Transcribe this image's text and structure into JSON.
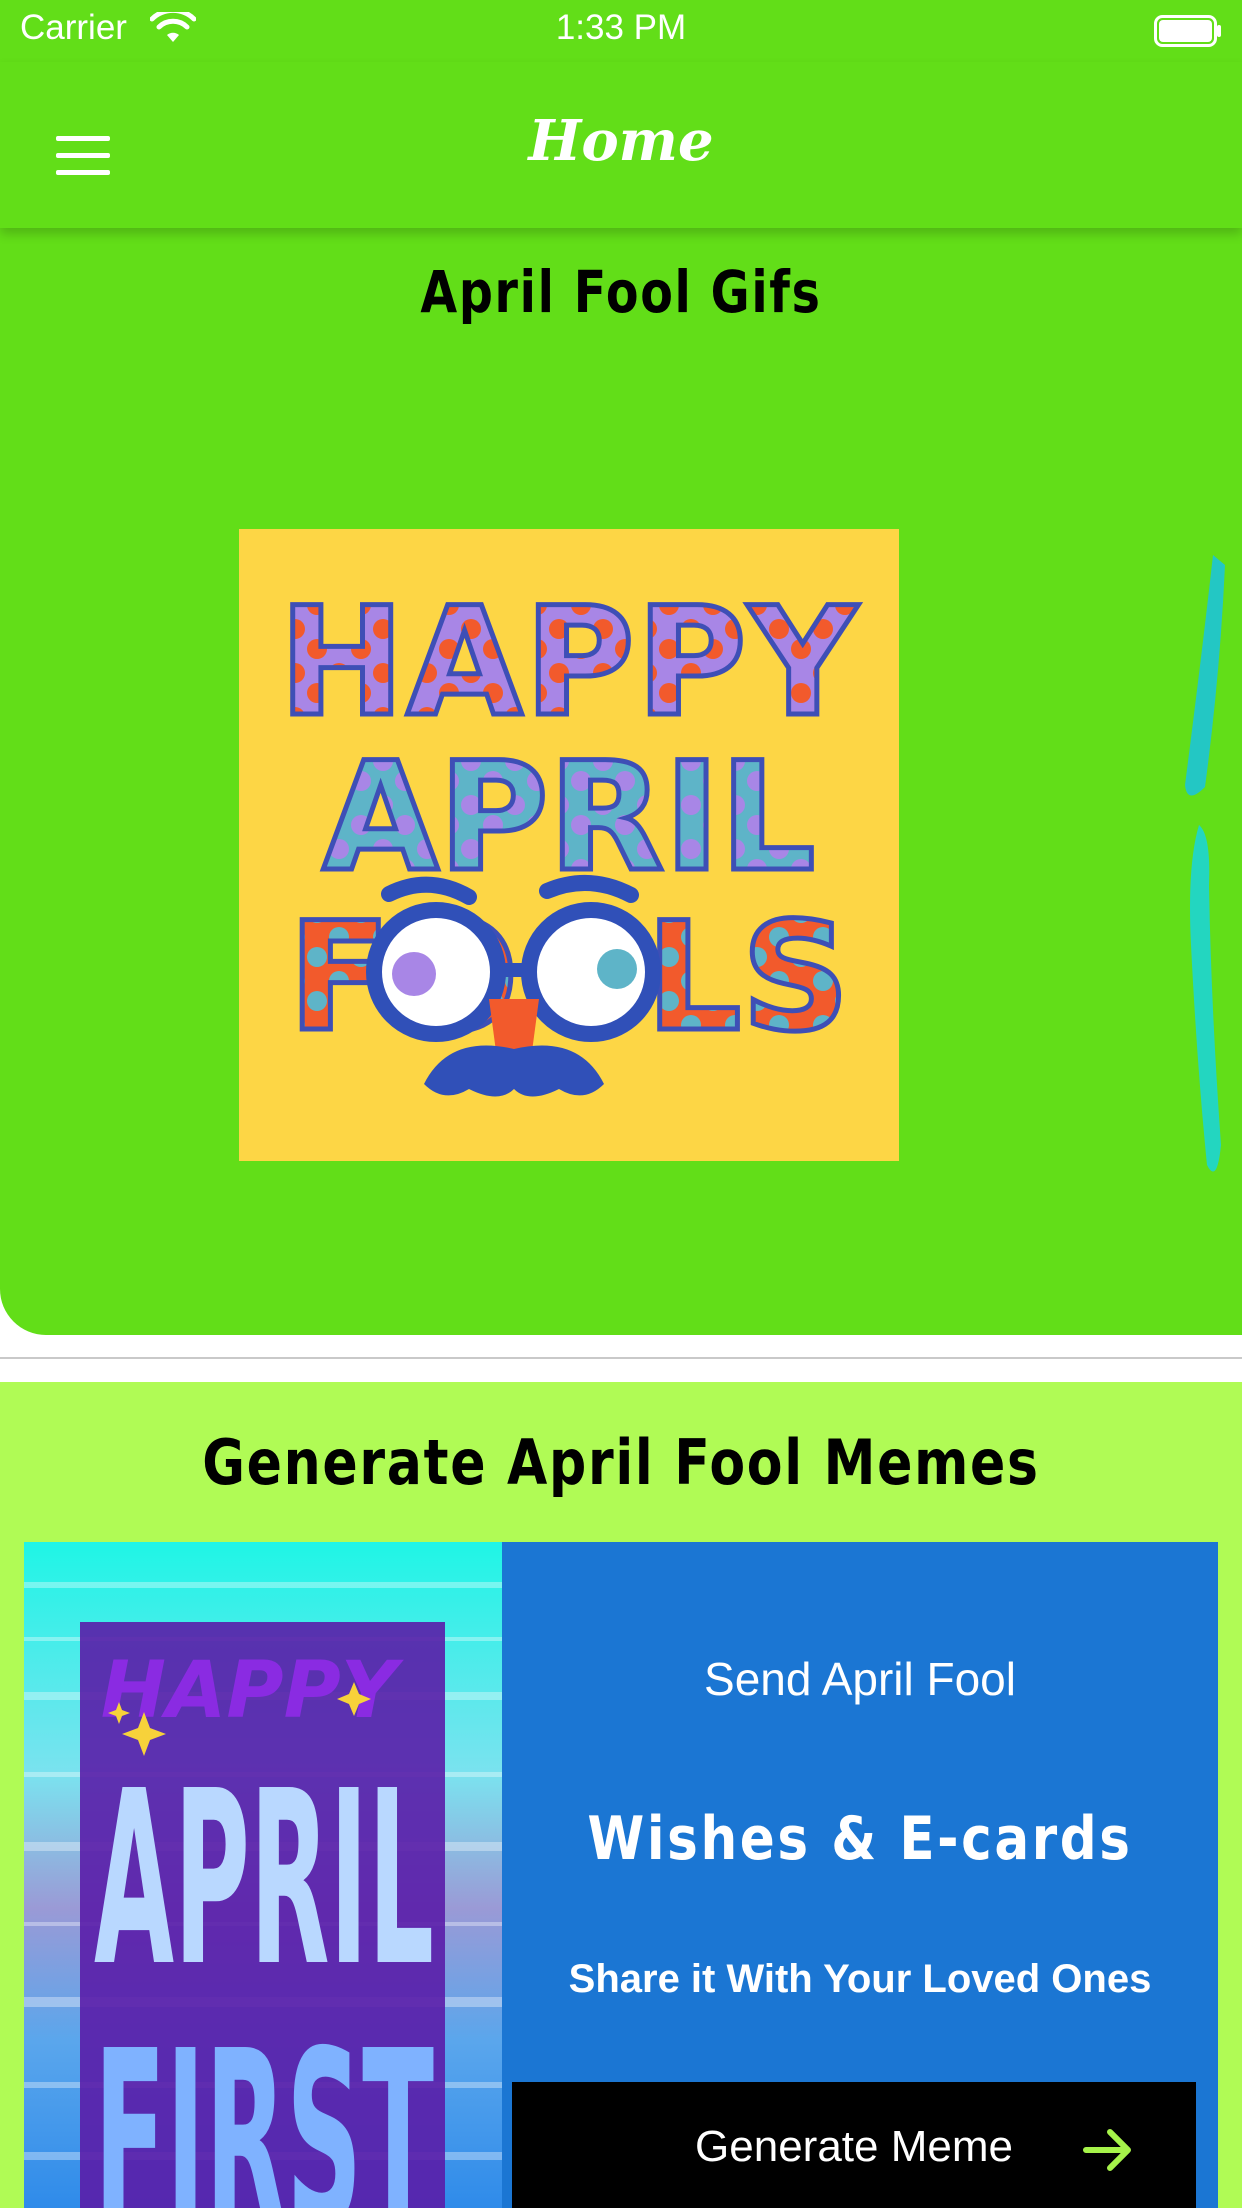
{
  "status_bar": {
    "carrier": "Carrier",
    "time": "1:33 PM"
  },
  "nav": {
    "title": "Home",
    "menu_icon": "hamburger-menu-icon"
  },
  "gif_section": {
    "title": "April Fool Gifs",
    "image_text": [
      "HAPPY",
      "APRIL",
      "FOOLS"
    ]
  },
  "meme_section": {
    "title": "Generate April Fool Memes",
    "image_text": [
      "HAPPY",
      "APRIL",
      "FIRST"
    ],
    "panel": {
      "line1": "Send April Fool",
      "line2": "Wishes & E-cards",
      "line3": "Share it With Your Loved Ones"
    },
    "button_label": "Generate Meme",
    "button_icon": "arrow-right-icon"
  },
  "colors": {
    "primary_green": "#62de18",
    "light_green": "#b0fb55",
    "panel_blue": "#1b76d3",
    "gif_background": "#fdd645",
    "button": "#000000",
    "arrow": "#a6f34a"
  }
}
